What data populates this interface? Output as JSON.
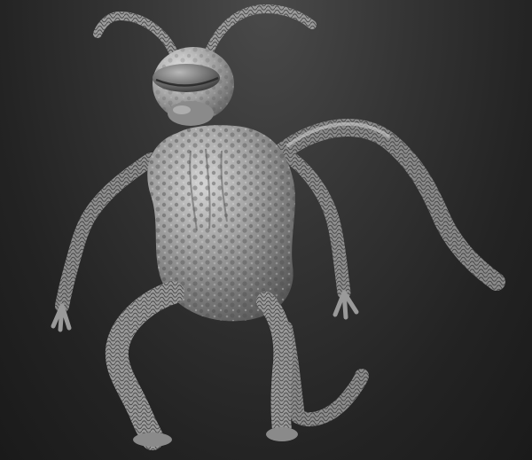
{
  "scene": {
    "subject": "creature-sculpt",
    "colors": {
      "background_top": "#4a4a4a",
      "background_bottom": "#1a1a1a",
      "clay_light": "#d4d4d4",
      "clay_mid": "#9a9a9a",
      "clay_dark": "#4e4e4e",
      "crack_line": "#2f2f2f"
    }
  }
}
